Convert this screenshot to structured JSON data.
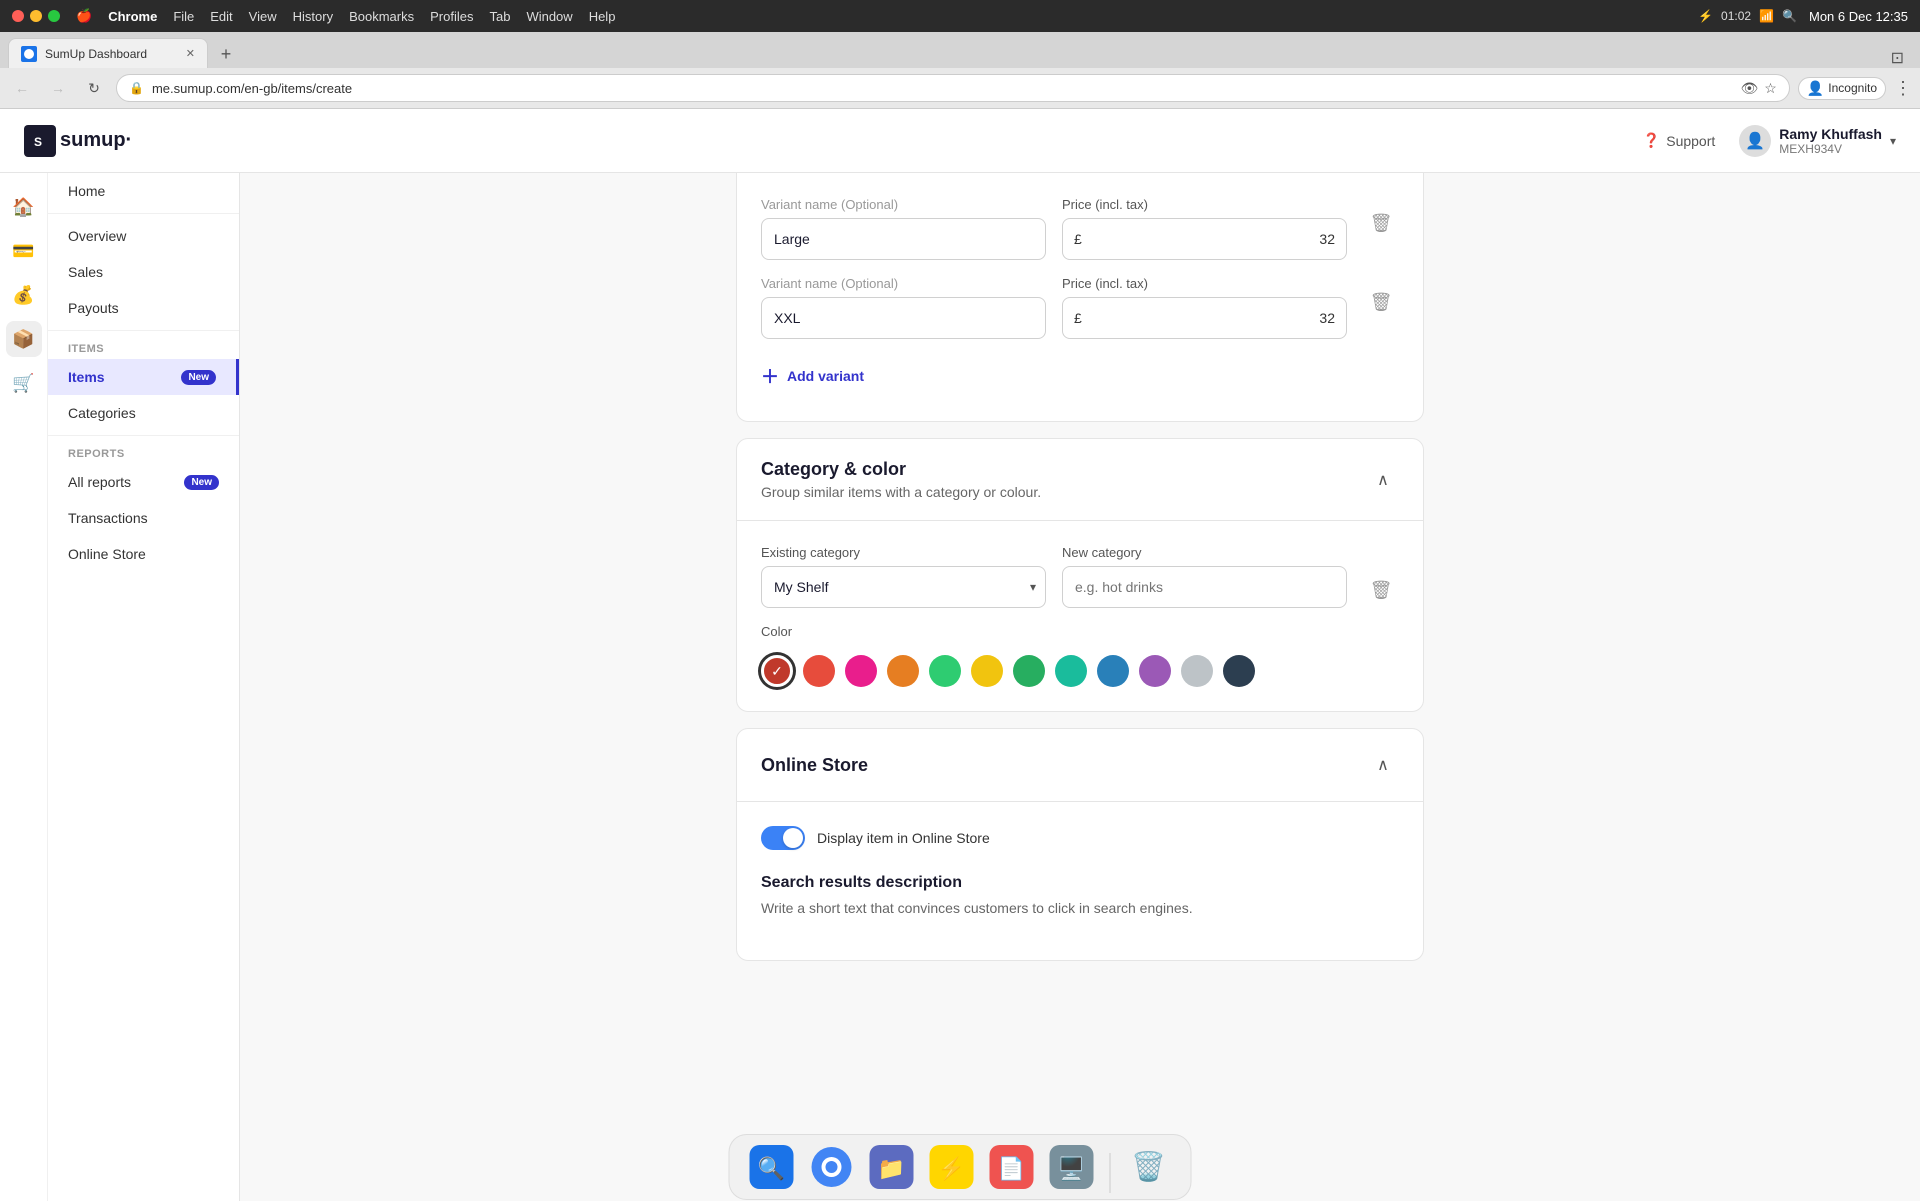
{
  "os": {
    "menu_bar": {
      "apple": "🍎",
      "chrome": "Chrome",
      "file": "File",
      "edit": "Edit",
      "view": "View",
      "history": "History",
      "bookmarks": "Bookmarks",
      "profiles": "Profiles",
      "tab": "Tab",
      "window": "Window",
      "help": "Help",
      "battery_icon": "⚡",
      "battery_time": "01:02",
      "time": "Mon 6 Dec  12:35"
    },
    "dock": {
      "items": [
        {
          "id": "finder",
          "icon": "🔍",
          "label": "Finder"
        },
        {
          "id": "chrome",
          "icon": "🌐",
          "label": "Chrome"
        },
        {
          "id": "folder",
          "icon": "📁",
          "label": "Folder"
        },
        {
          "id": "lightning",
          "icon": "⚡",
          "label": "App"
        },
        {
          "id": "pdf",
          "icon": "📄",
          "label": "PDF"
        },
        {
          "id": "app2",
          "icon": "🖥️",
          "label": "App2"
        },
        {
          "id": "trash",
          "icon": "🗑️",
          "label": "Trash"
        }
      ]
    }
  },
  "browser": {
    "tab_title": "SumUp Dashboard",
    "url": "me.sumup.com/en-gb/items/create",
    "profile": "Incognito"
  },
  "app": {
    "logo_text": "sumup·",
    "header": {
      "support_label": "Support",
      "user_name": "Ramy Khuffash",
      "user_id": "MEXH934V"
    },
    "sidebar": {
      "home_label": "Home",
      "overview_label": "Overview",
      "sales_label": "Sales",
      "payouts_label": "Payouts",
      "items_section": "ITEMS",
      "items_label": "Items",
      "items_badge": "New",
      "categories_label": "Categories",
      "reports_section": "REPORTS",
      "all_reports_label": "All reports",
      "all_reports_badge": "New",
      "transactions_label": "Transactions",
      "online_store_label": "Online Store"
    },
    "form": {
      "variant_section": {
        "variant1": {
          "label": "Variant name",
          "optional": "(Optional)",
          "value": "Large",
          "price_label": "Price (incl. tax)",
          "currency": "£",
          "price_value": "32"
        },
        "variant2": {
          "label": "Variant name",
          "optional": "(Optional)",
          "value": "XXL",
          "price_label": "Price (incl. tax)",
          "currency": "£",
          "price_value": "32"
        },
        "add_variant_label": "Add variant"
      },
      "category_section": {
        "title": "Category & color",
        "subtitle": "Group similar items with a category or colour.",
        "existing_category_label": "Existing category",
        "existing_category_value": "My Shelf",
        "new_category_label": "New category",
        "new_category_placeholder": "e.g. hot drinks",
        "color_label": "Color",
        "colors": [
          {
            "id": "red-check",
            "color": "#c0392b",
            "selected": true
          },
          {
            "id": "red",
            "color": "#e74c3c",
            "selected": false
          },
          {
            "id": "pink",
            "color": "#e91e63",
            "selected": false
          },
          {
            "id": "orange",
            "color": "#e67e22",
            "selected": false
          },
          {
            "id": "light-green",
            "color": "#2ecc71",
            "selected": false
          },
          {
            "id": "yellow",
            "color": "#f1c40f",
            "selected": false
          },
          {
            "id": "green",
            "color": "#27ae60",
            "selected": false
          },
          {
            "id": "teal",
            "color": "#1abc9c",
            "selected": false
          },
          {
            "id": "blue",
            "color": "#2980b9",
            "selected": false
          },
          {
            "id": "purple",
            "color": "#9b59b6",
            "selected": false
          },
          {
            "id": "gray",
            "color": "#bdc3c7",
            "selected": false
          },
          {
            "id": "black",
            "color": "#2c3e50",
            "selected": false
          }
        ]
      },
      "online_store_section": {
        "title": "Online Store",
        "toggle_label": "Display item in Online Store",
        "toggle_on": true,
        "search_title": "Search results description",
        "search_subtitle": "Write a short text that convinces customers to click in search engines."
      }
    }
  }
}
